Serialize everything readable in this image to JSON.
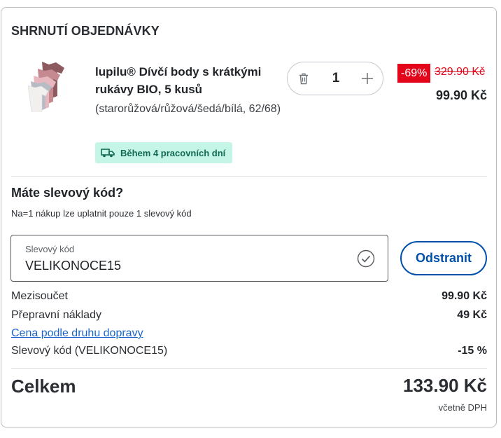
{
  "summary": {
    "title": "SHRNUTÍ OBJEDNÁVKY"
  },
  "product": {
    "thumbnail_icon": "baby-bodysuits-image",
    "name": "lupilu® Dívčí body s krátkými rukávy BIO, 5 kusů",
    "variant": "(starorůžová/růžová/šedá/bílá, 62/68)",
    "delivery": "Během 4 pracovních dní",
    "quantity": "1",
    "discount": "-69%",
    "old_price": "329.90 Kč",
    "price": "99.90 Kč"
  },
  "promo": {
    "heading": "Máte slevový kód?",
    "note": "Na=1 nákup lze uplatnit pouze 1 slevový kód",
    "field_label": "Slevový kód",
    "field_value": "VELIKONOCE15",
    "remove_label": "Odstranit"
  },
  "totals": {
    "subtotal_label": "Mezisoučet",
    "subtotal_value": "99.90 Kč",
    "shipping_label": "Přepravní náklady",
    "shipping_value": "49 Kč",
    "shipping_link": "Cena podle druhu dopravy",
    "code_label": "Slevový kód (VELIKONOCE15)",
    "code_value": "-15 %",
    "total_label": "Celkem",
    "total_value": "133.90 Kč",
    "vat_note": "včetně DPH"
  },
  "colors": {
    "accent_blue": "#0050aa",
    "sale_red": "#e3061b",
    "delivery_bg": "#c5f5e6",
    "delivery_text": "#136a53"
  }
}
